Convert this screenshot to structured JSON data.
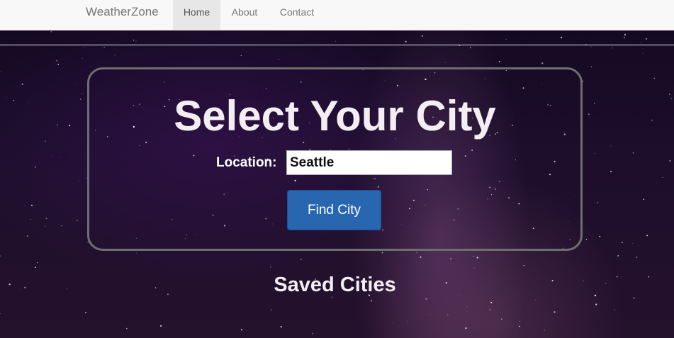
{
  "navbar": {
    "brand": "WeatherZone",
    "items": [
      {
        "label": "Home",
        "active": true
      },
      {
        "label": "About",
        "active": false
      },
      {
        "label": "Contact",
        "active": false
      }
    ]
  },
  "main": {
    "title": "Select Your City",
    "location_label": "Location:",
    "location_value": "Seattle",
    "find_button_label": "Find City",
    "saved_heading": "Saved Cities"
  },
  "colors": {
    "navbar_bg": "#f8f8f8",
    "active_tab_bg": "#e7e7e7",
    "button_bg": "#2966b0",
    "box_border": "#6e6e6e",
    "background": "#1d0e2c"
  }
}
